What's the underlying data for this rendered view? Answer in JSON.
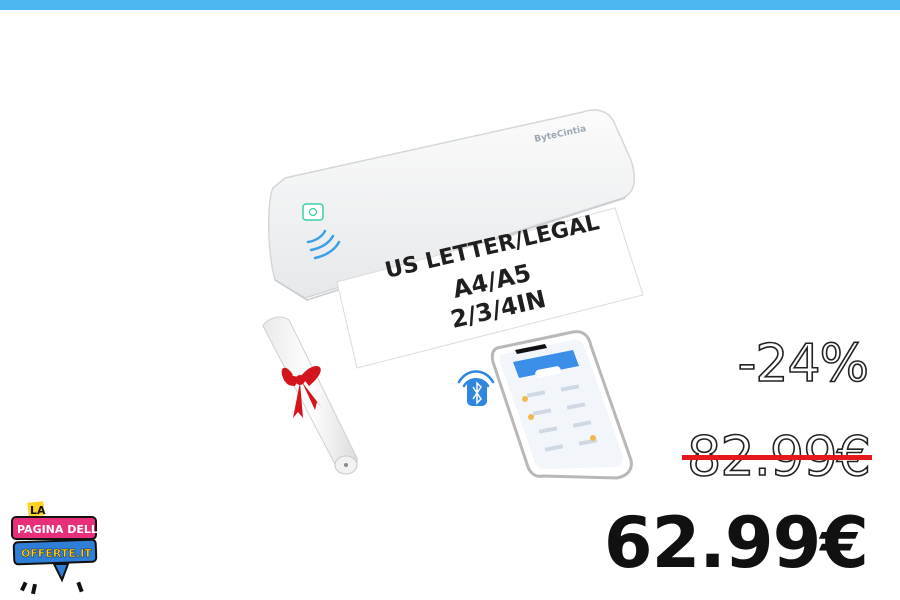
{
  "product": {
    "brand": "ByteCintia",
    "paper_lines": [
      "US LETTER/LEGAL",
      "A4/A5",
      "2/3/4IN"
    ]
  },
  "price": {
    "discount": "-24%",
    "old_price": "82.99€",
    "new_price": "62.99€"
  },
  "logo": {
    "line1": "LA",
    "line2": "PAGINA DELLE",
    "line3": "OFFERTE.IT"
  },
  "colors": {
    "top_bar": "#4cb7f0",
    "strike": "#e5191d",
    "logo_pink": "#e8307a",
    "logo_blue": "#2f7fd8",
    "logo_yellow": "#ffd21f"
  }
}
